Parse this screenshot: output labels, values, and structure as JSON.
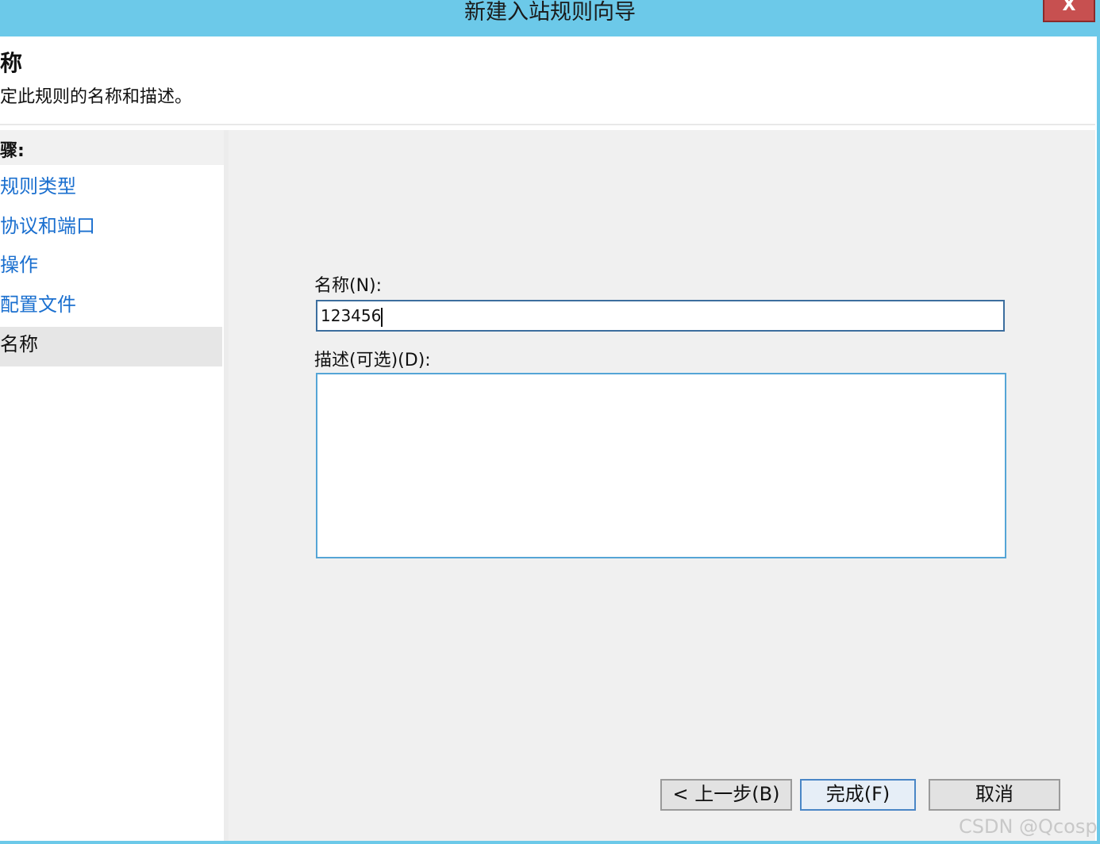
{
  "window": {
    "title": "新建入站规则向导",
    "close_label": "X"
  },
  "header": {
    "title": "称",
    "description": "定此规则的名称和描述。"
  },
  "sidebar": {
    "steps_title": "骤:",
    "steps": [
      {
        "label": "规则类型"
      },
      {
        "label": "协议和端口"
      },
      {
        "label": "操作"
      },
      {
        "label": "配置文件"
      },
      {
        "label": "名称"
      }
    ]
  },
  "form": {
    "name_label": "名称(N):",
    "name_value": "123456",
    "description_label": "描述(可选)(D):",
    "description_value": ""
  },
  "buttons": {
    "back": "< 上一步(B)",
    "finish": "完成(F)",
    "cancel": "取消"
  },
  "watermark": "CSDN @Qcosp",
  "colors": {
    "titlebar": "#6cc9e9",
    "link": "#1a6fcf",
    "close": "#c75050"
  }
}
